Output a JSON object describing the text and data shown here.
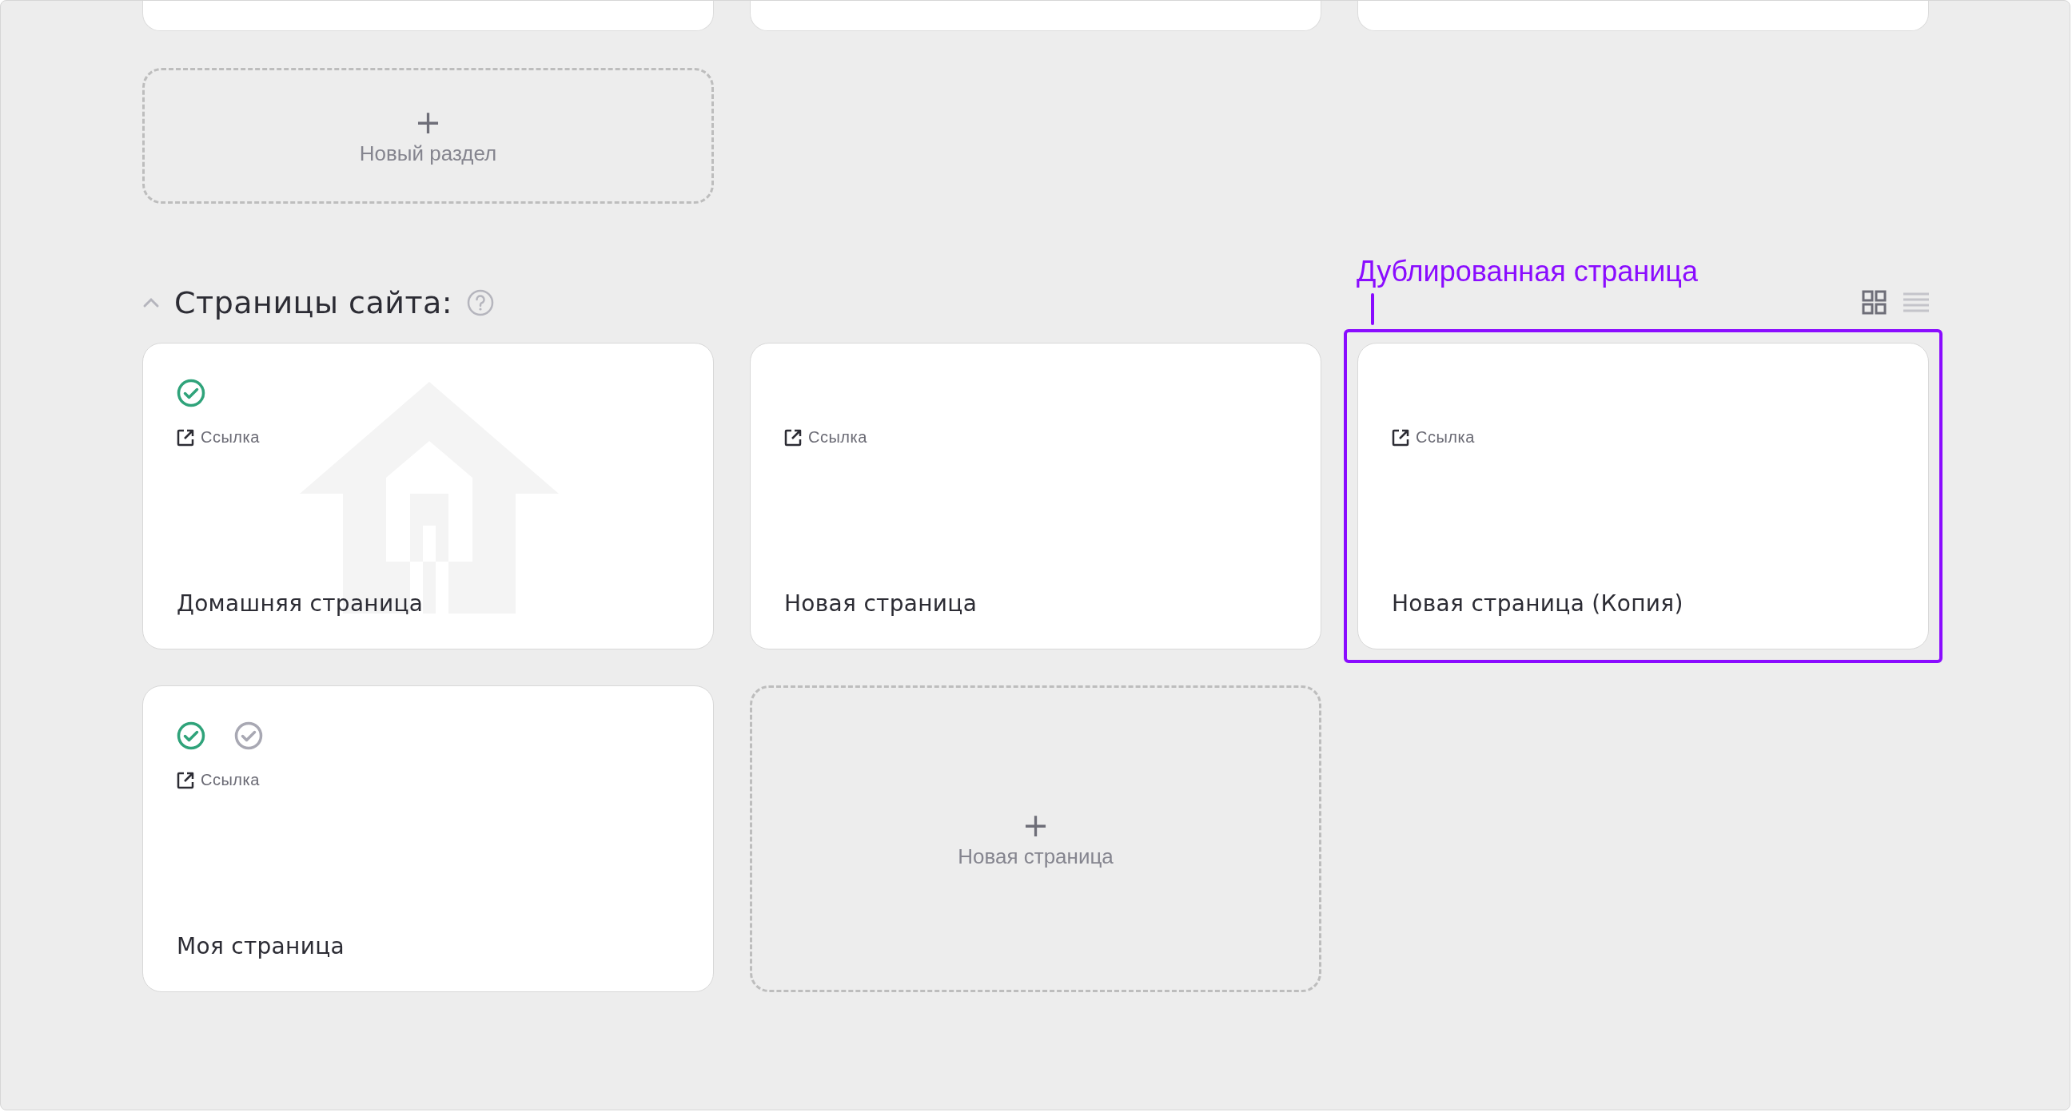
{
  "new_section": {
    "plus": "+",
    "label": "Новый раздел"
  },
  "section": {
    "title": "Страницы сайта:",
    "expanded": true
  },
  "view_toggle": [
    {
      "kind": "grid",
      "selected": true
    },
    {
      "kind": "list",
      "selected": false
    }
  ],
  "annotation": {
    "label": "Дублированная страница"
  },
  "pages": [
    {
      "title": "Домашняя страница",
      "link": "Ссылка",
      "home": true,
      "highlighted": false,
      "statuses": [
        {
          "active": true
        }
      ]
    },
    {
      "title": "Новая страница",
      "link": "Ссылка",
      "home": false,
      "highlighted": false
    },
    {
      "title": "Новая страница (Копия)",
      "link": "Ссылка",
      "home": false,
      "highlighted": true
    },
    {
      "title": "Моя страница",
      "link": "Ссылка",
      "home": false,
      "highlighted": false,
      "statuses": [
        {
          "active": true
        },
        {
          "active": false
        }
      ]
    }
  ],
  "new_page": {
    "plus": "+",
    "label": "Новая страница"
  }
}
